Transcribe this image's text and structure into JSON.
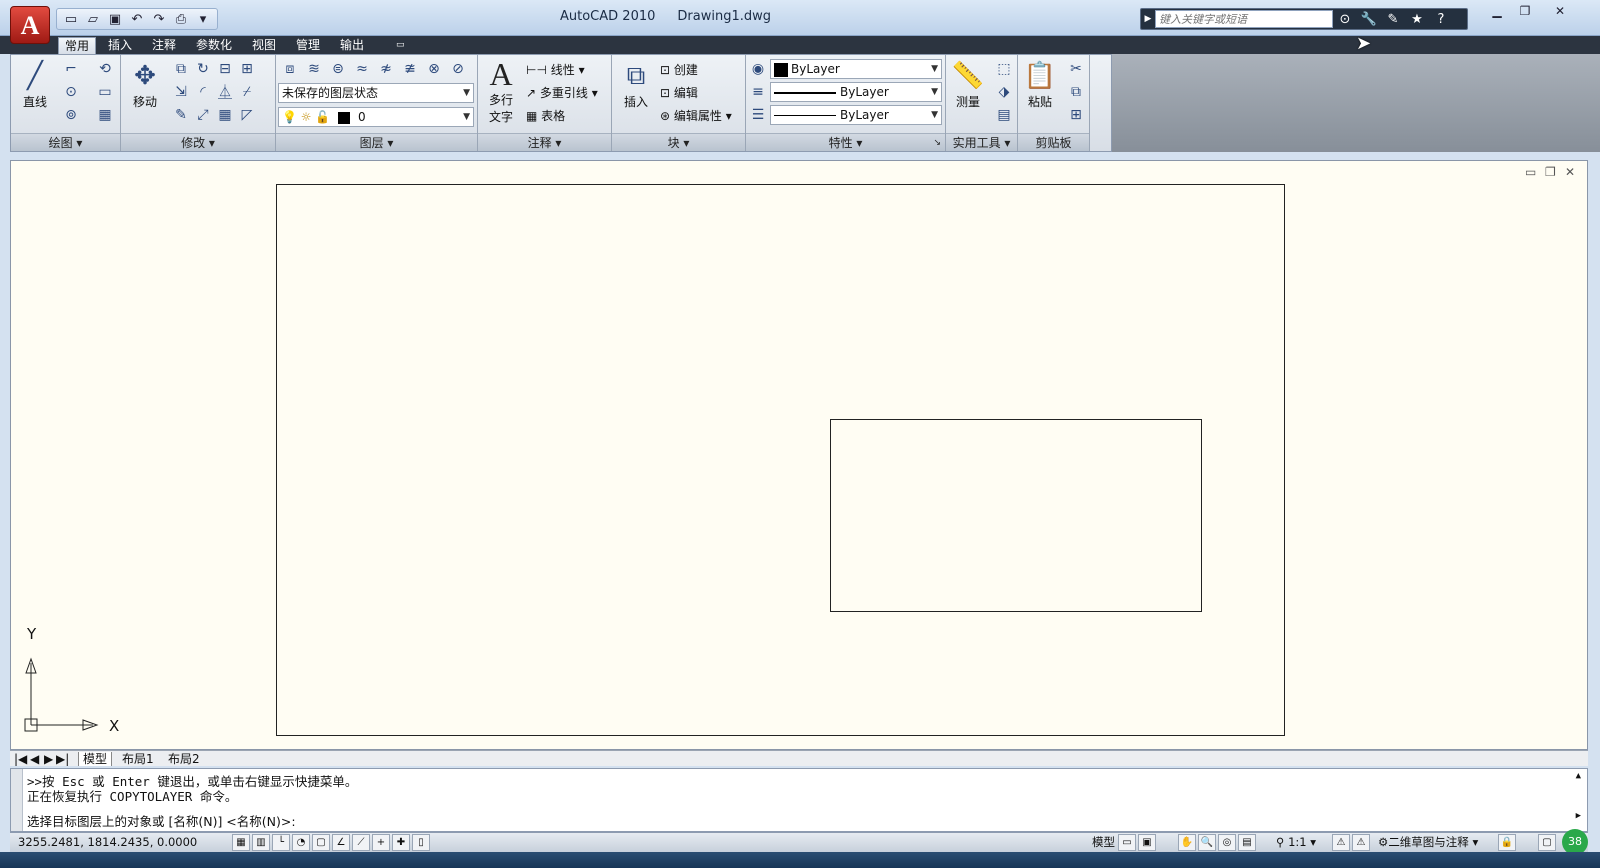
{
  "app": {
    "logo_letter": "A",
    "name": "AutoCAD 2010",
    "document": "Drawing1.dwg"
  },
  "qat": {
    "icons": [
      "new-icon",
      "open-icon",
      "save-icon",
      "undo-icon",
      "redo-icon",
      "plot-icon"
    ]
  },
  "search": {
    "placeholder": "键入关键字或短语"
  },
  "tabs": [
    "常用",
    "插入",
    "注释",
    "参数化",
    "视图",
    "管理",
    "输出"
  ],
  "panels": {
    "draw": {
      "title": "绘图",
      "line_label": "直线"
    },
    "modify": {
      "title": "修改",
      "move_label": "移动"
    },
    "layers": {
      "title": "图层",
      "layer_state": "未保存的图层状态",
      "current_layer": "0"
    },
    "annotation": {
      "title": "注释",
      "mtext_label": "多行\n文字",
      "mtext_top": "多行",
      "mtext_bottom": "文字",
      "linear": "线性",
      "mleader": "多重引线",
      "table": "表格"
    },
    "block": {
      "title": "块",
      "insert": "插入",
      "create": "创建",
      "edit": "编辑",
      "edit_attr": "编辑属性"
    },
    "properties": {
      "title": "特性",
      "color": "ByLayer",
      "lineweight": "ByLayer",
      "linetype": "ByLayer"
    },
    "utilities": {
      "title": "实用工具",
      "measure": "测量"
    },
    "clipboard": {
      "title": "剪贴板",
      "paste": "粘贴"
    }
  },
  "ucs": {
    "x_label": "X",
    "y_label": "Y"
  },
  "layout_tabs": [
    "模型",
    "布局1",
    "布局2"
  ],
  "command": {
    "line1": ">>按 Esc 或 Enter 键退出，或单击右键显示快捷菜单。",
    "line2": "正在恢复执行 COPYTOLAYER 命令。",
    "prompt": "选择目标图层上的对象或 [名称(N)] <名称(N)>:"
  },
  "status": {
    "coords": "3255.2481, 1814.2435, 0.0000",
    "model": "模型",
    "scale": "1:1",
    "workspace": "二维草图与注释",
    "notify": "38"
  }
}
